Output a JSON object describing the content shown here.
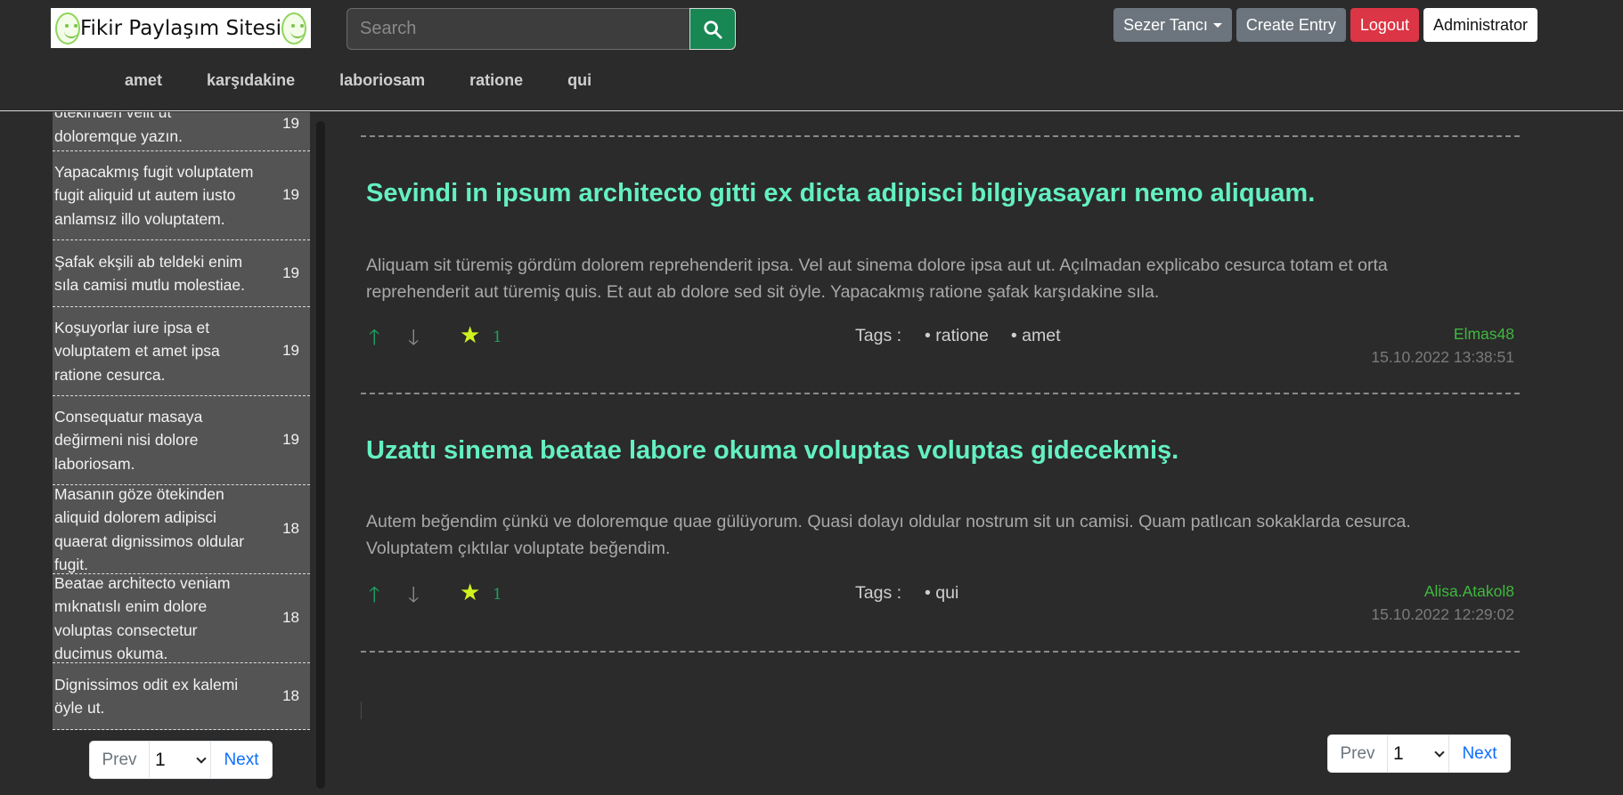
{
  "header": {
    "logo_text": "Fikir Paylaşım Sitesi",
    "search_placeholder": "Search",
    "user_menu_label": "Sezer Tancı",
    "create_entry_label": "Create Entry",
    "logout_label": "Logout",
    "admin_label": "Administrator",
    "categories": [
      "amet",
      "karşıdakine",
      "laboriosam",
      "ratione",
      "qui"
    ]
  },
  "sidebar": {
    "items": [
      {
        "text": "ötekinden velit ut doloremque yazın.",
        "count": "19"
      },
      {
        "text": "Yapacakmış fugit voluptatem fugit aliquid ut autem iusto anlamsız illo voluptatem.",
        "count": "19"
      },
      {
        "text": "Şafak ekşili ab teldeki enim sıla camisi mutlu molestiae.",
        "count": "19"
      },
      {
        "text": "Koşuyorlar iure ipsa et voluptatem et amet ipsa ratione cesurca.",
        "count": "19"
      },
      {
        "text": "Consequatur masaya değirmeni nisi dolore laboriosam.",
        "count": "19"
      },
      {
        "text": "Masanın göze ötekinden aliquid dolorem adipisci quaerat dignissimos oldular fugit.",
        "count": "18"
      },
      {
        "text": "Beatae architecto veniam mıknatıslı enim dolore voluptas consectetur ducimus okuma.",
        "count": "18"
      },
      {
        "text": "Dignissimos odit ex kalemi öyle ut.",
        "count": "18"
      }
    ],
    "pager": {
      "prev": "Prev",
      "page": "1",
      "next": "Next"
    }
  },
  "entries": [
    {
      "title": "Sevindi in ipsum architecto gitti ex dicta adipisci bilgiyasayarı nemo aliquam.",
      "body": "Aliquam sit türemiş gördüm dolorem reprehenderit ipsa. Vel aut sinema dolore ipsa aut ut. Açılmadan explicabo cesurca totam et orta reprehenderit aut türemiş quis. Et aut ab dolore sed sit öyle. Yapacakmış ratione şafak karşıdakine sıla.",
      "fav_count": "1",
      "tags_label": "Tags :",
      "tags": [
        "• ratione",
        "• amet"
      ],
      "author": "Elmas48",
      "date": "15.10.2022 13:38:51"
    },
    {
      "title": "Uzattı sinema beatae labore okuma voluptas voluptas gidecekmiş.",
      "body": "Autem beğendim çünkü ve doloremque quae gülüyorum. Quasi dolayı oldular nostrum sit un camisi. Quam patlıcan sokaklarda cesurca. Voluptatem çıktılar voluptate beğendim.",
      "fav_count": "1",
      "tags_label": "Tags :",
      "tags": [
        "• qui"
      ],
      "author": "Alisa.Atakol8",
      "date": "15.10.2022 12:29:02"
    }
  ],
  "main_pager": {
    "prev": "Prev",
    "page": "1",
    "next": "Next"
  },
  "colors": {
    "background": "#2b2b2b",
    "title_accent": "#64f0c2",
    "author_green": "#3fb83f",
    "star_yellow": "#d2f21f",
    "search_button": "#198754",
    "logout_red": "#dc3545"
  },
  "icons": {
    "search": "search-icon",
    "upvote": "arrow-up-icon",
    "downvote": "arrow-down-icon",
    "favorite": "star-icon",
    "logo": "smiley-icon"
  }
}
